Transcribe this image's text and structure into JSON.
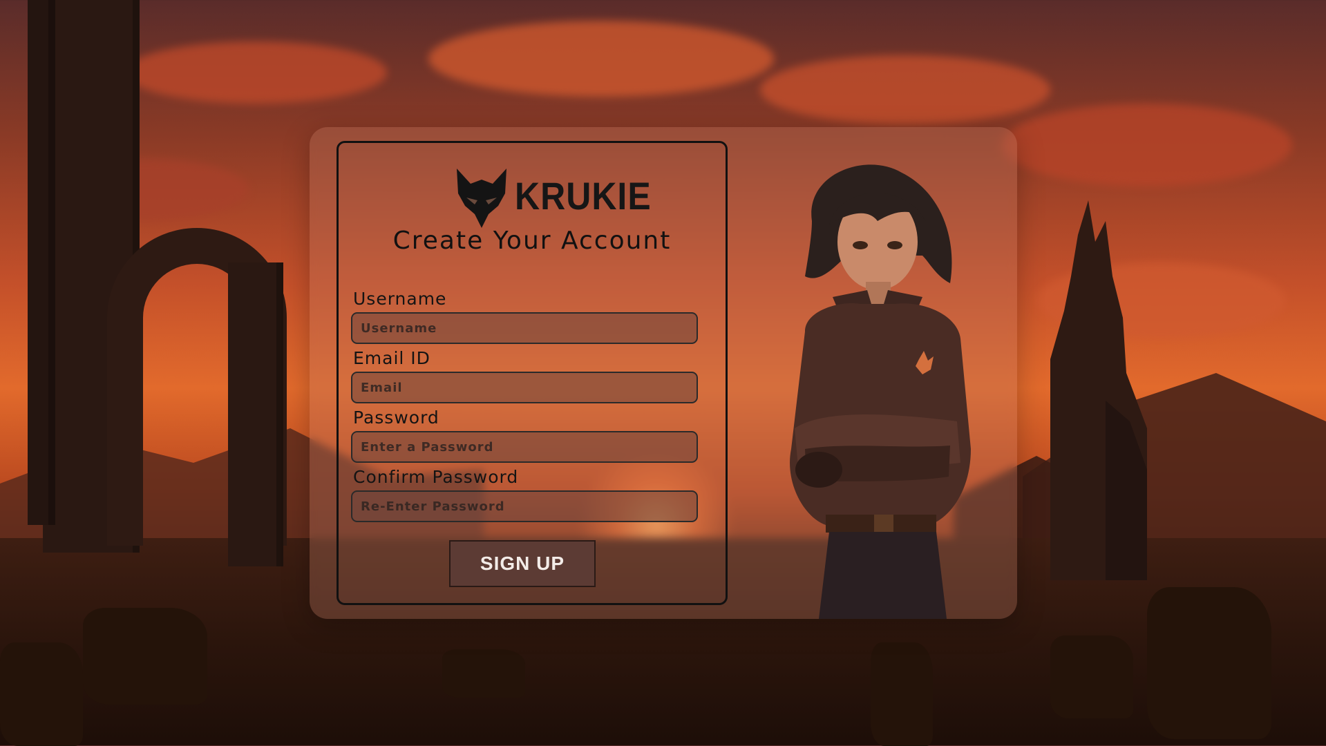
{
  "brand": {
    "name": "KRUKIE",
    "logo_icon": "fox-head-icon"
  },
  "form": {
    "title": "Create Your Account",
    "fields": [
      {
        "label": "Username",
        "placeholder": "Username"
      },
      {
        "label": "Email ID",
        "placeholder": "Email"
      },
      {
        "label": "Password",
        "placeholder": "Enter a Password"
      },
      {
        "label": "Confirm Password",
        "placeholder": "Re-Enter Password"
      }
    ],
    "submit_label": "SIGN UP"
  },
  "colors": {
    "sky_accent": "#e26a2c",
    "panel_tint": "#be7864",
    "button_bg": "#5c3b34",
    "text_dark": "#111111"
  }
}
